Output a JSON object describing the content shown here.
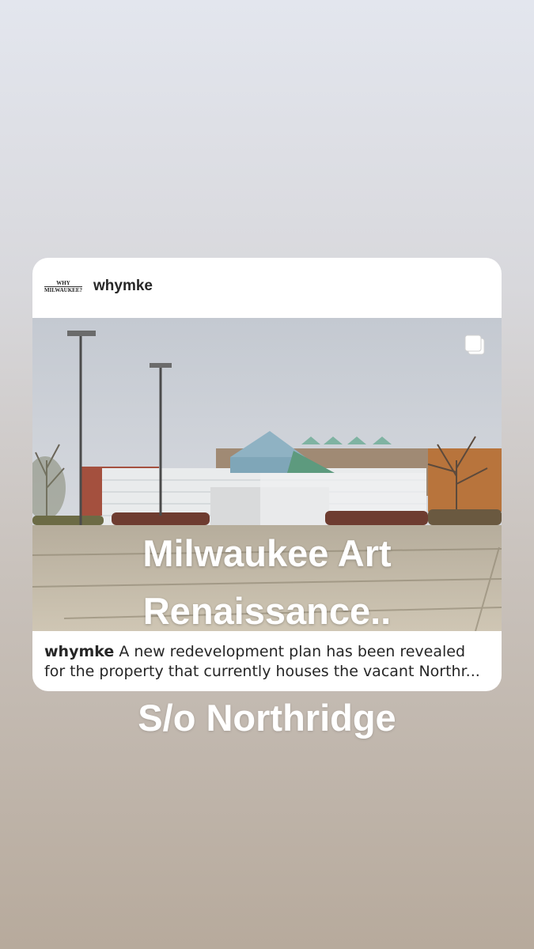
{
  "post": {
    "avatar_text_line1": "WHY",
    "avatar_text_line2": "MILWAUKEE?",
    "username": "whymke",
    "overlay_line1": "Milwaukee Art",
    "overlay_line2": "Renaissance..",
    "caption_user": "whymke",
    "caption_line1": "A new redevelopment plan has been revealed",
    "caption_line2": "for the property that currently houses the vacant Northr..."
  },
  "story": {
    "text": "S/o Northridge"
  },
  "icons": {
    "multi_post": "carousel-icon"
  }
}
